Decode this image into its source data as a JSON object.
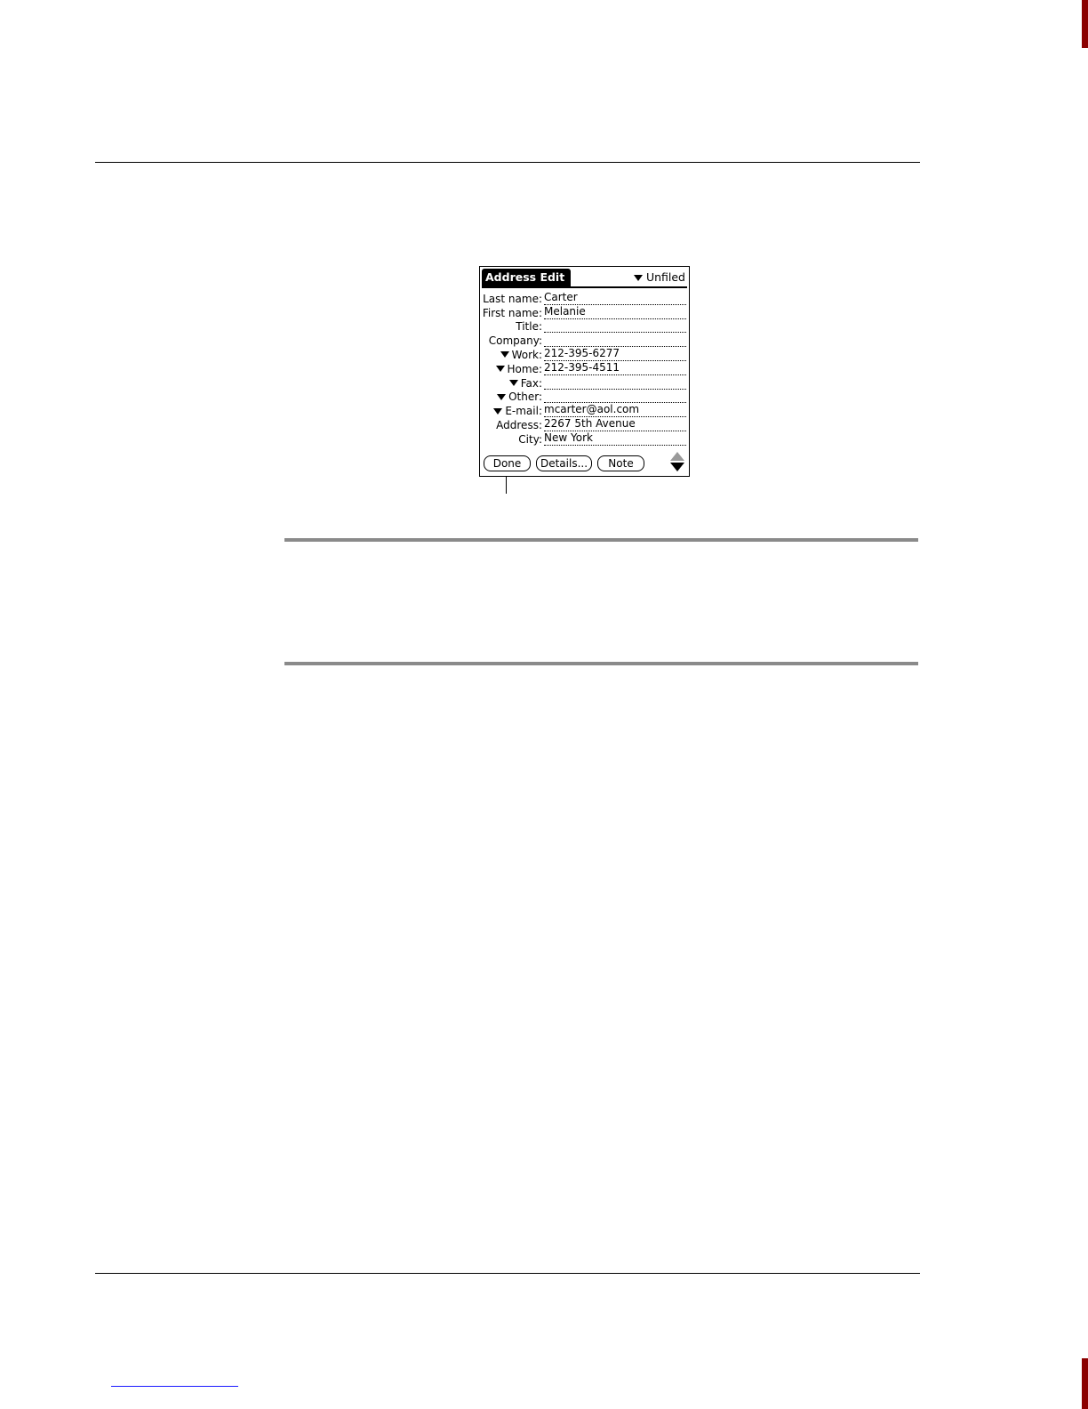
{
  "screen": {
    "title": "Address Edit",
    "category": "Unfiled",
    "fields": [
      {
        "label": "Last name:",
        "value": "Carter",
        "dropdown": false
      },
      {
        "label": "First name:",
        "value": "Melanie",
        "dropdown": false
      },
      {
        "label": "Title:",
        "value": "",
        "dropdown": false
      },
      {
        "label": "Company:",
        "value": "",
        "dropdown": false
      },
      {
        "label": "Work:",
        "value": "212-395-6277",
        "dropdown": true
      },
      {
        "label": "Home:",
        "value": "212-395-4511",
        "dropdown": true
      },
      {
        "label": "Fax:",
        "value": "",
        "dropdown": true
      },
      {
        "label": "Other:",
        "value": "",
        "dropdown": true
      },
      {
        "label": "E-mail:",
        "value": "mcarter@aol.com",
        "dropdown": true
      },
      {
        "label": "Address:",
        "value": "2267 5th Avenue",
        "dropdown": false
      },
      {
        "label": "City:",
        "value": "New York",
        "dropdown": false
      }
    ],
    "buttons": {
      "done": "Done",
      "details": "Details...",
      "note": "Note"
    },
    "icons": {
      "category_arrow": "chevron-down-icon",
      "scroll": "scroll-arrows-icon"
    }
  },
  "colors": {
    "rule_gray": "#8a8a8a",
    "page_edge": "#8b0000",
    "link": "#1a1aff"
  }
}
